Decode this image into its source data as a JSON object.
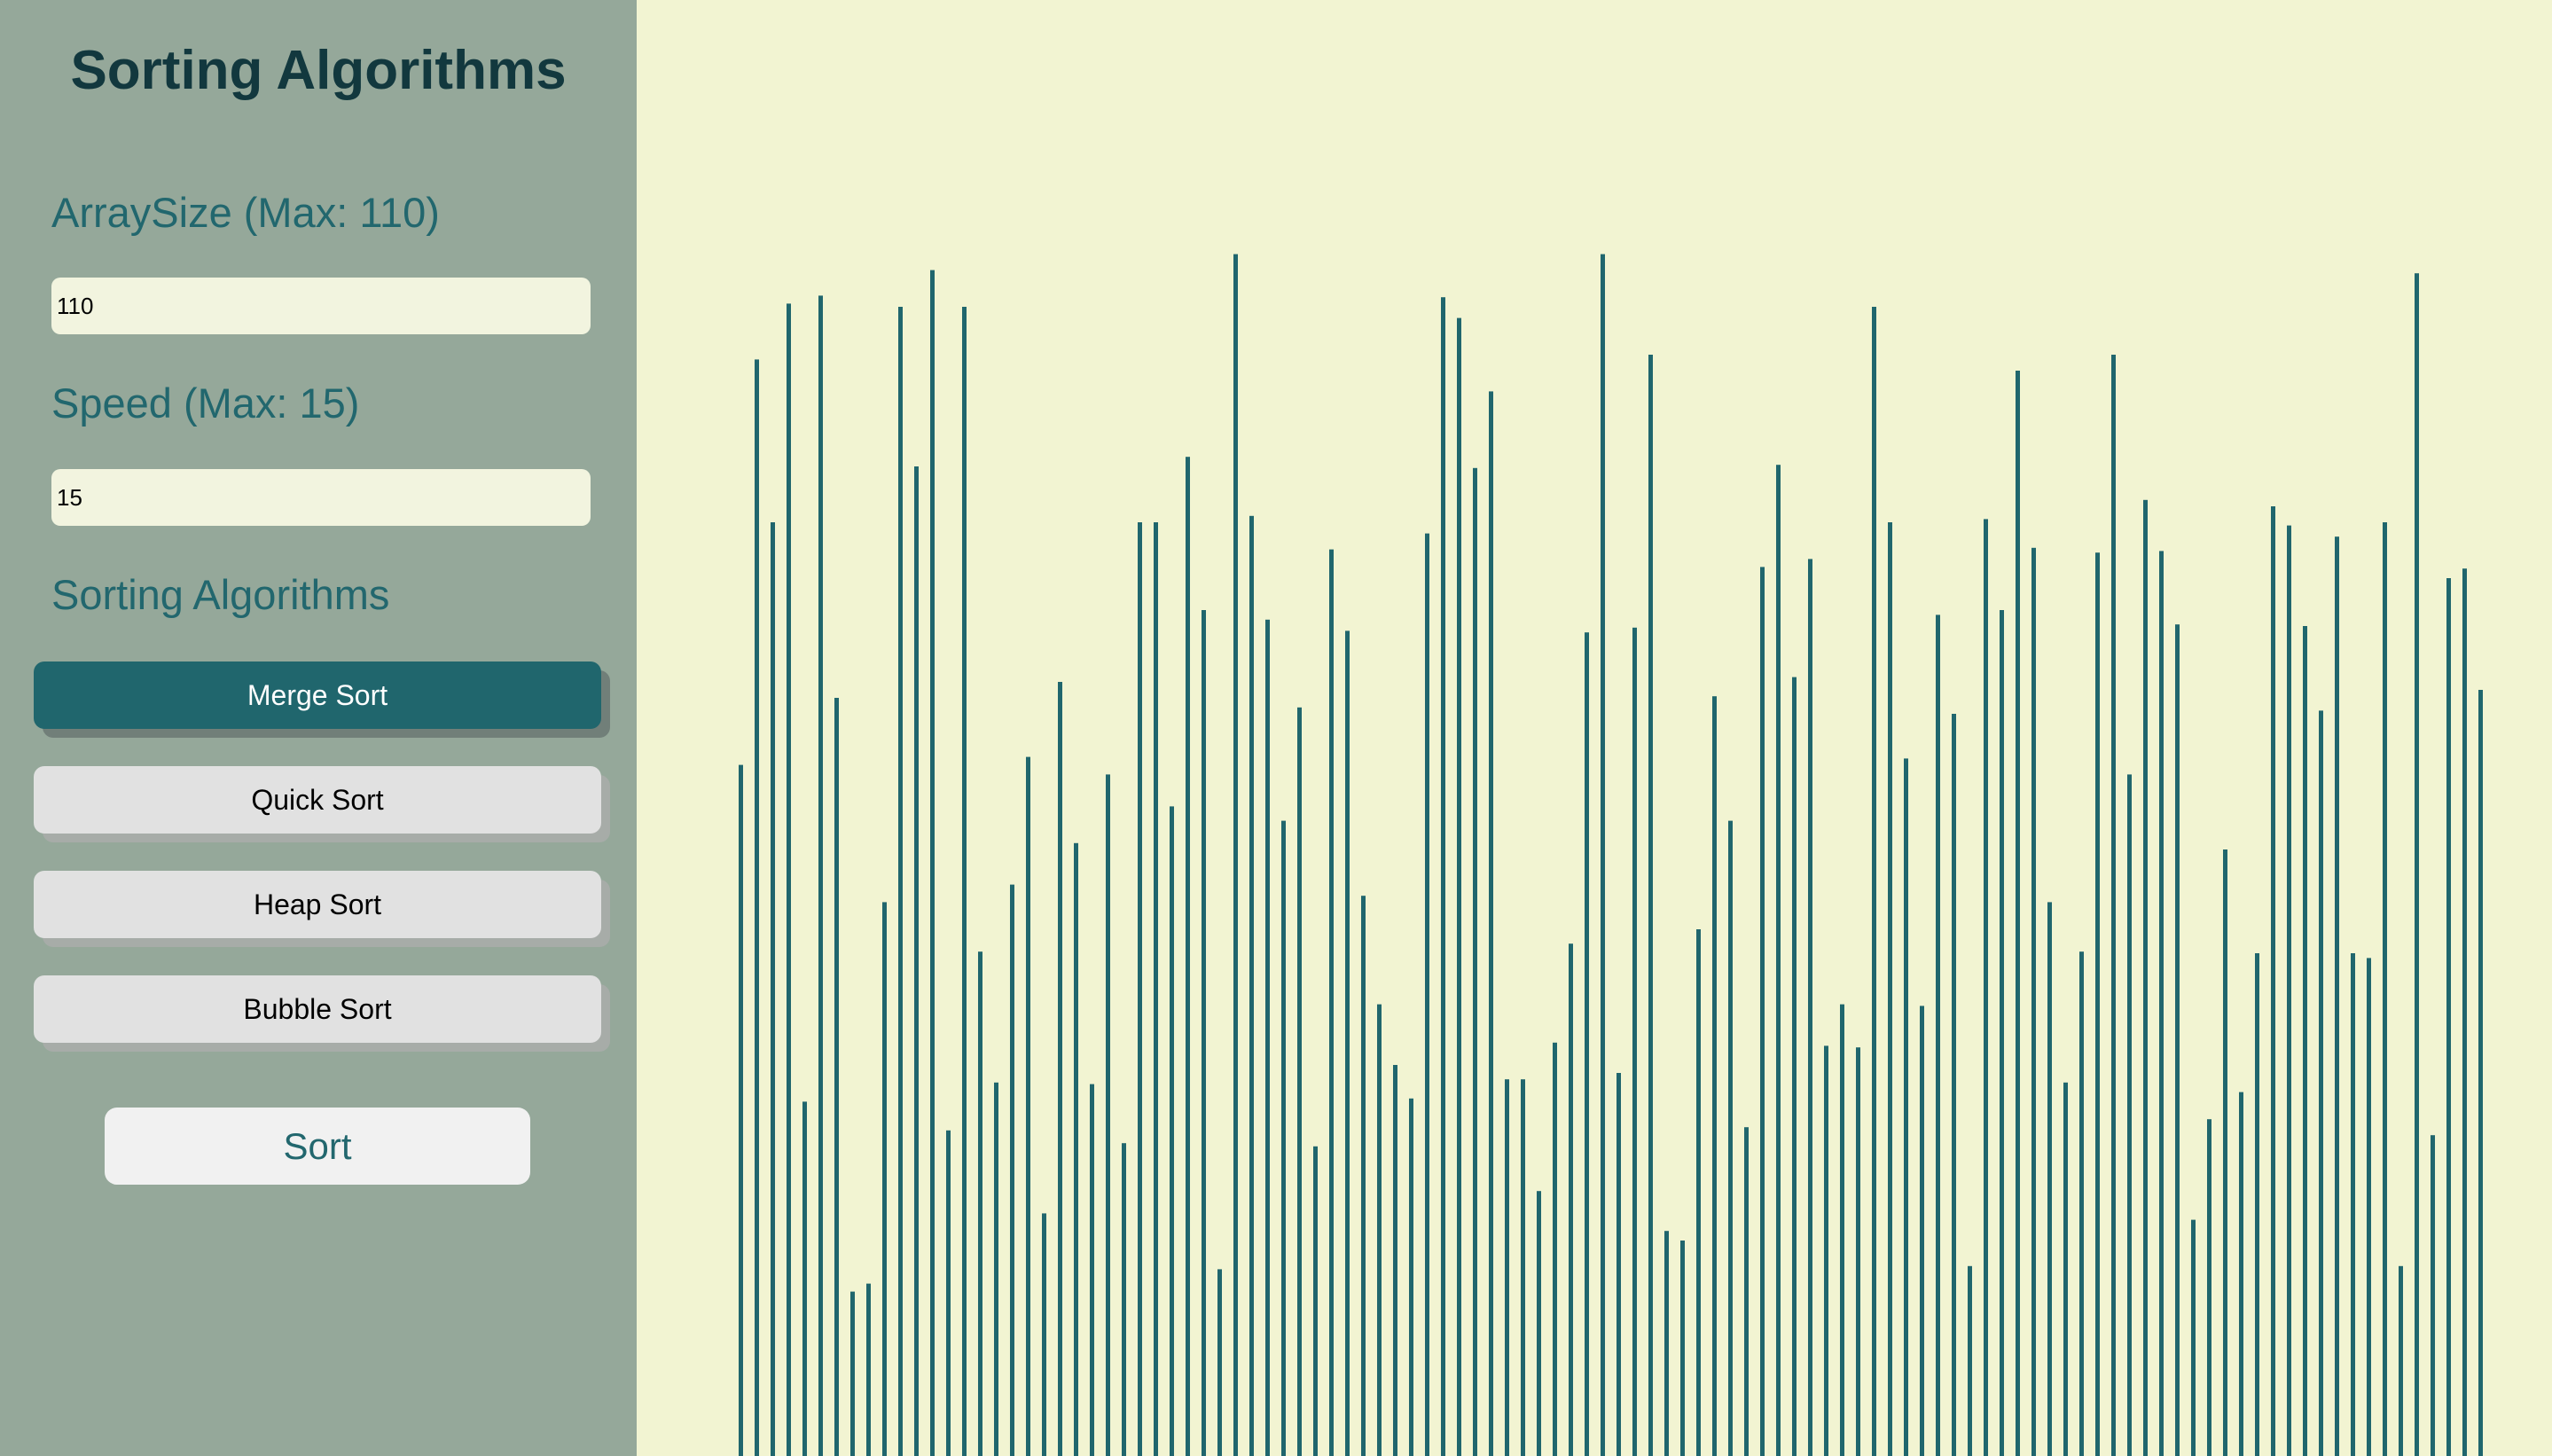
{
  "sidebar": {
    "title": "Sorting Algorithms",
    "array_size": {
      "label": "ArraySize (Max: 110)",
      "value": "110"
    },
    "speed": {
      "label": "Speed (Max: 15)",
      "value": "15"
    },
    "algorithms": {
      "label": "Sorting Algorithms",
      "items": [
        {
          "label": "Merge Sort",
          "selected": true
        },
        {
          "label": "Quick Sort",
          "selected": false
        },
        {
          "label": "Heap Sort",
          "selected": false
        },
        {
          "label": "Bubble Sort",
          "selected": false
        }
      ]
    },
    "sort_button": "Sort"
  },
  "array": {
    "size": 110,
    "bar_color": "#20666d",
    "values": [
      433,
      687,
      585,
      722,
      222,
      727,
      475,
      103,
      108,
      347,
      720,
      620,
      743,
      204,
      720,
      316,
      234,
      358,
      438,
      152,
      485,
      384,
      233,
      427,
      196,
      585,
      585,
      407,
      626,
      530,
      117,
      753,
      589,
      524,
      398,
      469,
      194,
      568,
      517,
      351,
      283,
      245,
      224,
      578,
      726,
      713,
      619,
      667,
      236,
      236,
      166,
      259,
      321,
      516,
      753,
      240,
      519,
      690,
      141,
      135,
      330,
      476,
      398,
      206,
      557,
      621,
      488,
      562,
      257,
      283,
      256,
      720,
      585,
      437,
      282,
      527,
      465,
      119,
      587,
      530,
      680,
      569,
      347,
      234,
      316,
      566,
      690,
      427,
      599,
      567,
      521,
      148,
      211,
      380,
      228,
      315,
      595,
      583,
      520,
      467,
      576,
      315,
      312,
      585,
      119,
      741,
      201,
      550,
      556,
      480
    ]
  }
}
